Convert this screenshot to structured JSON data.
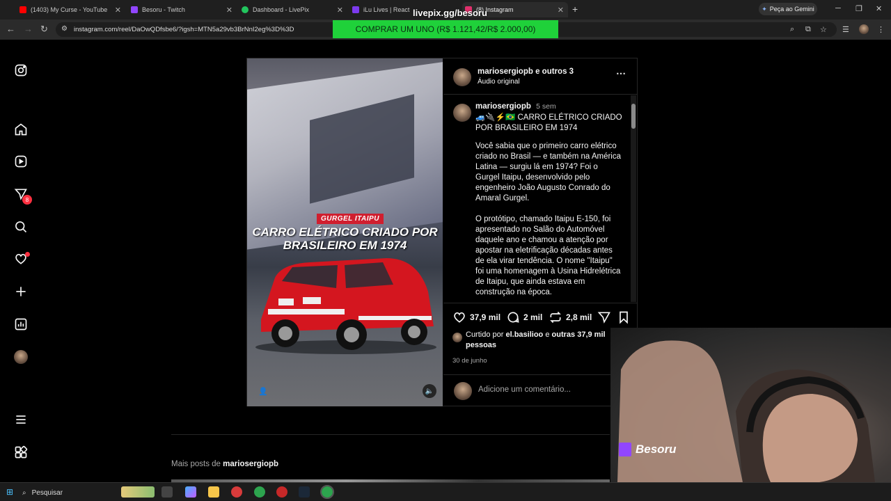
{
  "browser": {
    "tabs": [
      {
        "title": "(1403) My Curse - YouTube",
        "color": "#ff0000"
      },
      {
        "title": "Besoru - Twitch",
        "color": "#9146ff"
      },
      {
        "title": "Dashboard - LivePix",
        "color": "#22c55e"
      },
      {
        "title": "iLu Lives | React",
        "color": "#7c3aed"
      },
      {
        "title": "(8) Instagram",
        "color": "#e1306c"
      }
    ],
    "new_tab": "+",
    "gemini_label": "Peça ao Gemini",
    "url": "instagram.com/reel/DaOwQDfsbe6/?igsh=MTN5a29vb3BrNnI2eg%3D%3D"
  },
  "overlay": {
    "livepix_logo": "livepix.gg/besoru",
    "livepix_banner": "COMPRAR UM UNO (R$ 1.121,42/R$ 2.000,00)",
    "streamer_name": "Besoru"
  },
  "sidebar": {
    "notification_count": "8",
    "icons": [
      "instagram-logo-icon",
      "home-icon",
      "reels-icon",
      "messages-icon",
      "search-icon",
      "notifications-icon",
      "create-icon",
      "dashboard-icon",
      "profile-avatar",
      "menu-icon",
      "more-apps-icon"
    ]
  },
  "post": {
    "image_badge": "GURGEL ITAIPU",
    "image_headline": "CARRO ELÉTRICO CRIADO POR BRASILEIRO EM 1974",
    "author": "mariosergiopb",
    "coauthors": "e outros 3",
    "audio": "Áudio original",
    "caption_user": "mariosergiopb",
    "caption_time": "5 sem",
    "caption_head": "🚙🔌⚡🇧🇷 CARRO ELÉTRICO CRIADO POR BRASILEIRO EM 1974",
    "caption_body": "Você sabia que o primeiro carro elétrico criado no Brasil — e também na América Latina — surgiu lá em 1974? Foi o Gurgel Itaipu, desenvolvido pelo engenheiro João Augusto Conrado do Amaral Gurgel.\n\nO protótipo, chamado Itaipu E-150, foi apresentado no Salão do Automóvel daquele ano e chamou a atenção por apostar na eletrificação décadas antes de ela virar tendência. O nome \"Itaipu\" foi uma homenagem à Usina Hidrelétrica de Itaipu, que ainda estava em construção na época.",
    "likes": "37,9 mil",
    "comments": "2 mil",
    "reposts": "2,8 mil",
    "liked_by_prefix": "Curtido por",
    "liked_by_user": "el.basilioo",
    "liked_by_joiner": "e",
    "liked_by_rest": "outras 37,9 mil pessoas",
    "date": "30 de junho",
    "comment_placeholder": "Adicione um comentário..."
  },
  "more_posts": {
    "prefix": "Mais posts de",
    "user": "mariosergiopb"
  },
  "taskbar": {
    "search_label": "Pesquisar"
  }
}
